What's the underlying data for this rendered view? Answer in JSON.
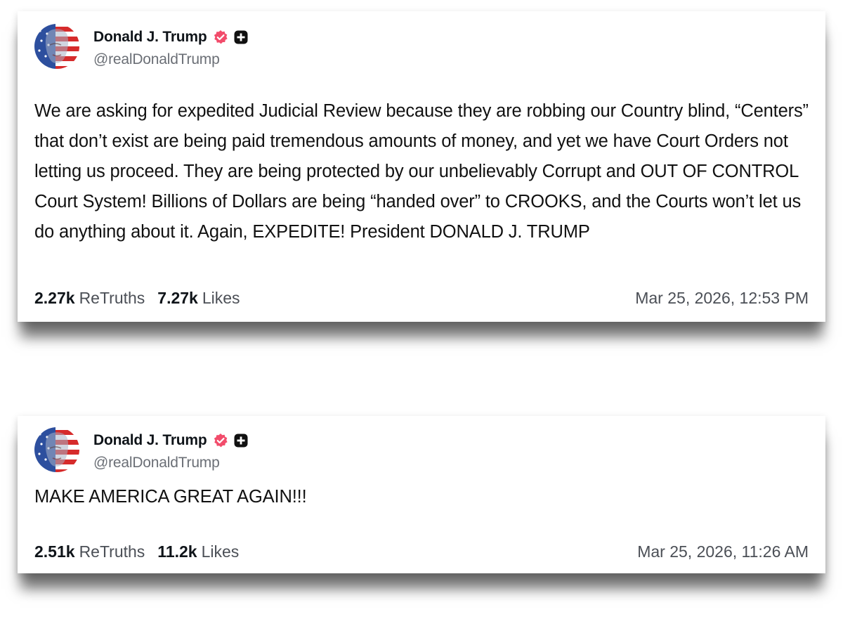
{
  "colors": {
    "verified_badge": "#f24c6b",
    "plus_badge": "#111111",
    "handle_text": "#6b6f76",
    "body_text": "#111111"
  },
  "posts": [
    {
      "author": {
        "display_name": "Donald J. Trump",
        "handle": "@realDonaldTrump",
        "verified_icon": "verified-badge-icon",
        "plus_icon": "plus-badge-icon"
      },
      "text": "We are asking for expedited Judicial Review because they are robbing our Country blind, “Centers” that don’t exist are being paid tremendous amounts of money, and yet we have Court Orders not letting us proceed. They are being protected by our unbelievably Corrupt and OUT OF CONTROL Court System! Billions of Dollars are being “handed over” to CROOKS, and the Courts won’t let us do anything about it. Again, EXPEDITE! President DONALD J. TRUMP",
      "retruths_count": "2.27k",
      "retruths_label": "ReTruths",
      "likes_count": "7.27k",
      "likes_label": "Likes",
      "timestamp": "Mar 25, 2026, 12:53 PM"
    },
    {
      "author": {
        "display_name": "Donald J. Trump",
        "handle": "@realDonaldTrump",
        "verified_icon": "verified-badge-icon",
        "plus_icon": "plus-badge-icon"
      },
      "text": "MAKE AMERICA GREAT AGAIN!!!",
      "retruths_count": "2.51k",
      "retruths_label": "ReTruths",
      "likes_count": "11.2k",
      "likes_label": "Likes",
      "timestamp": "Mar 25, 2026, 11:26 AM"
    }
  ]
}
